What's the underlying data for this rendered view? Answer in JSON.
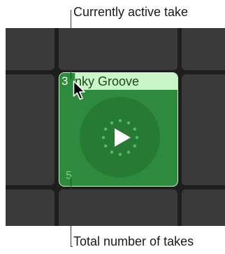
{
  "callouts": {
    "active_take": "Currently active take",
    "total_takes": "Total number of takes"
  },
  "clip": {
    "active_take_number": "3",
    "name": "nky Groove",
    "total_takes": "5"
  },
  "icons": {
    "play": "play-icon",
    "cursor": "arrow-cursor-icon"
  },
  "colors": {
    "grid_background": "#1e1e1e",
    "empty_cell": "#3a3a3a",
    "clip_fill": "#2e8b3d",
    "clip_header": "#c9f5c9",
    "clip_border": "#c8f2c8"
  }
}
